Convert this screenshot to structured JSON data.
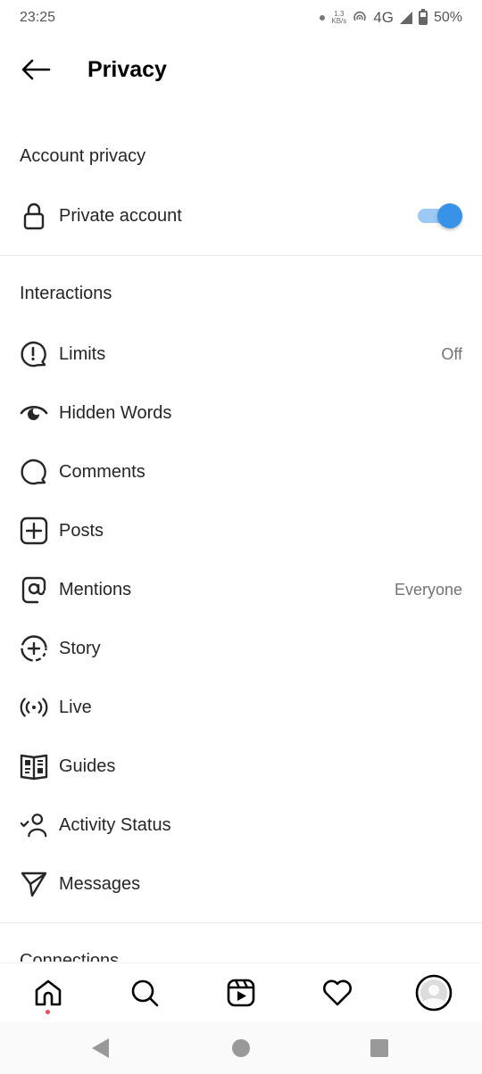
{
  "status_bar": {
    "time": "23:25",
    "net_speed_value": "1.3",
    "net_speed_unit": "KB/s",
    "network_type": "4G",
    "battery_percent": "50%"
  },
  "header": {
    "title": "Privacy"
  },
  "account_privacy": {
    "section_title": "Account privacy",
    "private_account": {
      "label": "Private account",
      "icon": "lock-icon",
      "enabled": true
    }
  },
  "interactions": {
    "section_title": "Interactions",
    "items": [
      {
        "label": "Limits",
        "value": "Off",
        "icon": "limits-icon"
      },
      {
        "label": "Hidden Words",
        "value": "",
        "icon": "hidden-words-icon"
      },
      {
        "label": "Comments",
        "value": "",
        "icon": "comment-icon"
      },
      {
        "label": "Posts",
        "value": "",
        "icon": "add-post-icon"
      },
      {
        "label": "Mentions",
        "value": "Everyone",
        "icon": "mention-icon"
      },
      {
        "label": "Story",
        "value": "",
        "icon": "story-icon"
      },
      {
        "label": "Live",
        "value": "",
        "icon": "live-icon"
      },
      {
        "label": "Guides",
        "value": "",
        "icon": "guides-icon"
      },
      {
        "label": "Activity Status",
        "value": "",
        "icon": "activity-status-icon"
      },
      {
        "label": "Messages",
        "value": "",
        "icon": "messages-icon"
      }
    ]
  },
  "connections": {
    "section_title": "Connections"
  },
  "bottom_nav": {
    "items": [
      "home",
      "search",
      "reels",
      "activity",
      "profile"
    ],
    "home_notification": true
  },
  "colors": {
    "toggle_on": "#3893e8",
    "notification_dot": "#ed4956"
  }
}
